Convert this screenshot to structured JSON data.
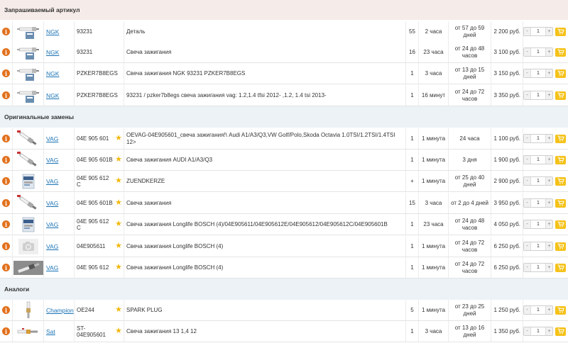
{
  "sections": {
    "requested": "Запрашиваемый артикул",
    "original": "Оригинальные замены",
    "analogs": "Аналоги"
  },
  "colors": {
    "info": "#e2711d",
    "brand_link": "#1a73b5",
    "star": "#f2b80c",
    "cart": "#f5c219"
  },
  "rows": [
    {
      "thumb": "spark-plug-box",
      "brand": "NGK",
      "article": "93231",
      "starred": false,
      "desc": "Деталь",
      "qty": "55",
      "delivery": "2 часа",
      "term": "от 57 до 59 дней",
      "price": "2 200 руб.",
      "count": "1"
    },
    {
      "thumb": "spark-plug-box",
      "brand": "NGK",
      "article": "93231",
      "starred": false,
      "desc": "Свеча зажигания",
      "qty": "16",
      "delivery": "23 часа",
      "term": "от 24 до 48 часов",
      "price": "3 100 руб.",
      "count": "1"
    },
    {
      "thumb": "spark-plug-box",
      "brand": "NGK",
      "article": "PZKER7B8EGS",
      "starred": false,
      "desc": "Свеча зажигания NGK 93231 PZKER7B8EGS",
      "qty": "1",
      "delivery": "3 часа",
      "term": "от 13 до 15 дней",
      "price": "3 150 руб.",
      "count": "1"
    },
    {
      "thumb": "spark-plug-box",
      "brand": "NGK",
      "article": "PZKER7B8EGS",
      "starred": false,
      "desc": "93231 / pzker7b8egs свеча зажигания vag: 1.2,1.4 tfsi 2012- ,1.2, 1.4 tsi 2013-",
      "qty": "1",
      "delivery": "16 минут",
      "term": "от 24 до 72 часов",
      "price": "3 350 руб.",
      "count": "1"
    },
    {
      "thumb": "spark-plug-diag",
      "brand": "VAG",
      "article": "04E 905 601",
      "starred": true,
      "desc": "OEVAG-04E905601_свеча зажигания!\\ Audi A1/A3/Q3,VW Golf/Polo,Skoda Octavia 1.0TSI/1.2TSI/1.4TSI 12>",
      "qty": "1",
      "delivery": "1 минута",
      "term": "24 часа",
      "price": "1 100 руб.",
      "count": "1"
    },
    {
      "thumb": "spark-plug-diag",
      "brand": "VAG",
      "article": "04E 905 601B",
      "starred": true,
      "desc": "Свеча зажигания AUDI A1/A3/Q3",
      "qty": "1",
      "delivery": "1 минута",
      "term": "3 дня",
      "price": "1 900 руб.",
      "count": "1"
    },
    {
      "thumb": "spark-plug-pack",
      "brand": "VAG",
      "article": "04E 905 612 C",
      "starred": true,
      "desc": "ZUENDKERZE",
      "qty": "+",
      "delivery": "1 минута",
      "term": "от 25 до 40 дней",
      "price": "2 900 руб.",
      "count": "1"
    },
    {
      "thumb": "spark-plug-diag",
      "brand": "VAG",
      "article": "04E 905 601B",
      "starred": true,
      "desc": "Свеча зажигания",
      "qty": "15",
      "delivery": "3 часа",
      "term": "от 2 до 4 дней",
      "price": "3 950 руб.",
      "count": "1"
    },
    {
      "thumb": "spark-plug-pack",
      "brand": "VAG",
      "article": "04E 905 612 C",
      "starred": true,
      "desc": "Свеча зажигания Longlife BOSCH (4)/04E905611/04E905612E/04E905612/04E905612C/04E905601B",
      "qty": "1",
      "delivery": "23 часа",
      "term": "от 24 до 48 часов",
      "price": "4 050 руб.",
      "count": "1"
    },
    {
      "thumb": "camera-placeholder",
      "brand": "VAG",
      "article": "04E905611",
      "starred": true,
      "desc": "Свеча зажигания Longlife BOSCH (4)",
      "qty": "1",
      "delivery": "1 минута",
      "term": "от 24 до 72 часов",
      "price": "6 250 руб.",
      "count": "1"
    },
    {
      "thumb": "spark-plug-photo",
      "brand": "VAG",
      "article": "04E 905 612",
      "starred": true,
      "desc": "Свеча зажигания Longlife BOSCH (4)",
      "qty": "1",
      "delivery": "1 минута",
      "term": "от 24 до 72 часов",
      "price": "6 250 руб.",
      "count": "1"
    },
    {
      "thumb": "spark-plug-vertical",
      "brand": "Champion",
      "article": "OE244",
      "starred": true,
      "desc": "SPARK PLUG",
      "qty": "5",
      "delivery": "1 минута",
      "term": "от 23 до 25 дней",
      "price": "1 250 руб.",
      "count": "1"
    },
    {
      "thumb": "spark-plug-horizontal",
      "brand": "Sat",
      "article": "ST-04E905601",
      "starred": true,
      "desc": "Свеча зажигания 13 1,4 12",
      "qty": "1",
      "delivery": "3 часа",
      "term": "от 13 до 16 дней",
      "price": "1 350 руб.",
      "count": "1"
    }
  ],
  "icons": {
    "info": "info-icon",
    "star": "star-icon",
    "cart": "cart-icon",
    "minus": "minus-icon",
    "plus": "plus-icon"
  },
  "stepper": {
    "minus": "-",
    "plus": "+"
  },
  "info_glyph": "i",
  "star_glyph": "★"
}
